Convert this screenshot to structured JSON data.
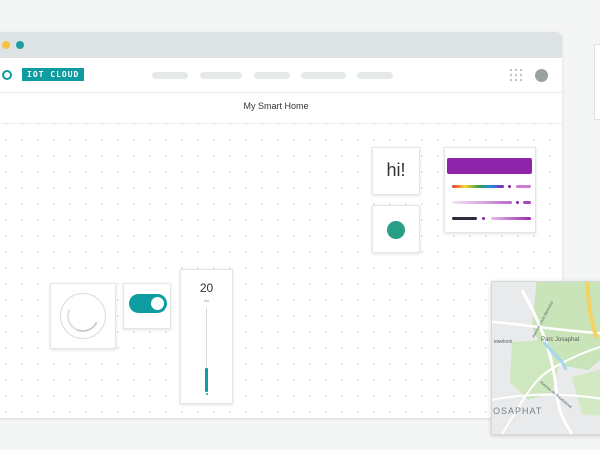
{
  "app": {
    "brand": "IOT CLOUD",
    "page_title": "My Smart Home"
  },
  "colors": {
    "brand_teal": "#0e9ca0",
    "led_green": "#2a9d86",
    "color_widget_purple": "#8e24aa",
    "window_dot_yellow": "#f5c242",
    "window_dot_teal": "#1d9ea0"
  },
  "icons": {
    "apps": "apps-grid-icon",
    "logo": "infinity-logo-icon"
  },
  "widgets": {
    "message": {
      "text": "hi!"
    },
    "slider": {
      "value": "20",
      "unit": "km",
      "level": 0.2
    },
    "switch": {
      "state": "on"
    },
    "map": {
      "labels": [
        "Parc Josaphat",
        "OSAPHAT",
        "ewekoni",
        "Avenue Louis Bertrand",
        "Avenue de Roodebeek"
      ]
    }
  }
}
